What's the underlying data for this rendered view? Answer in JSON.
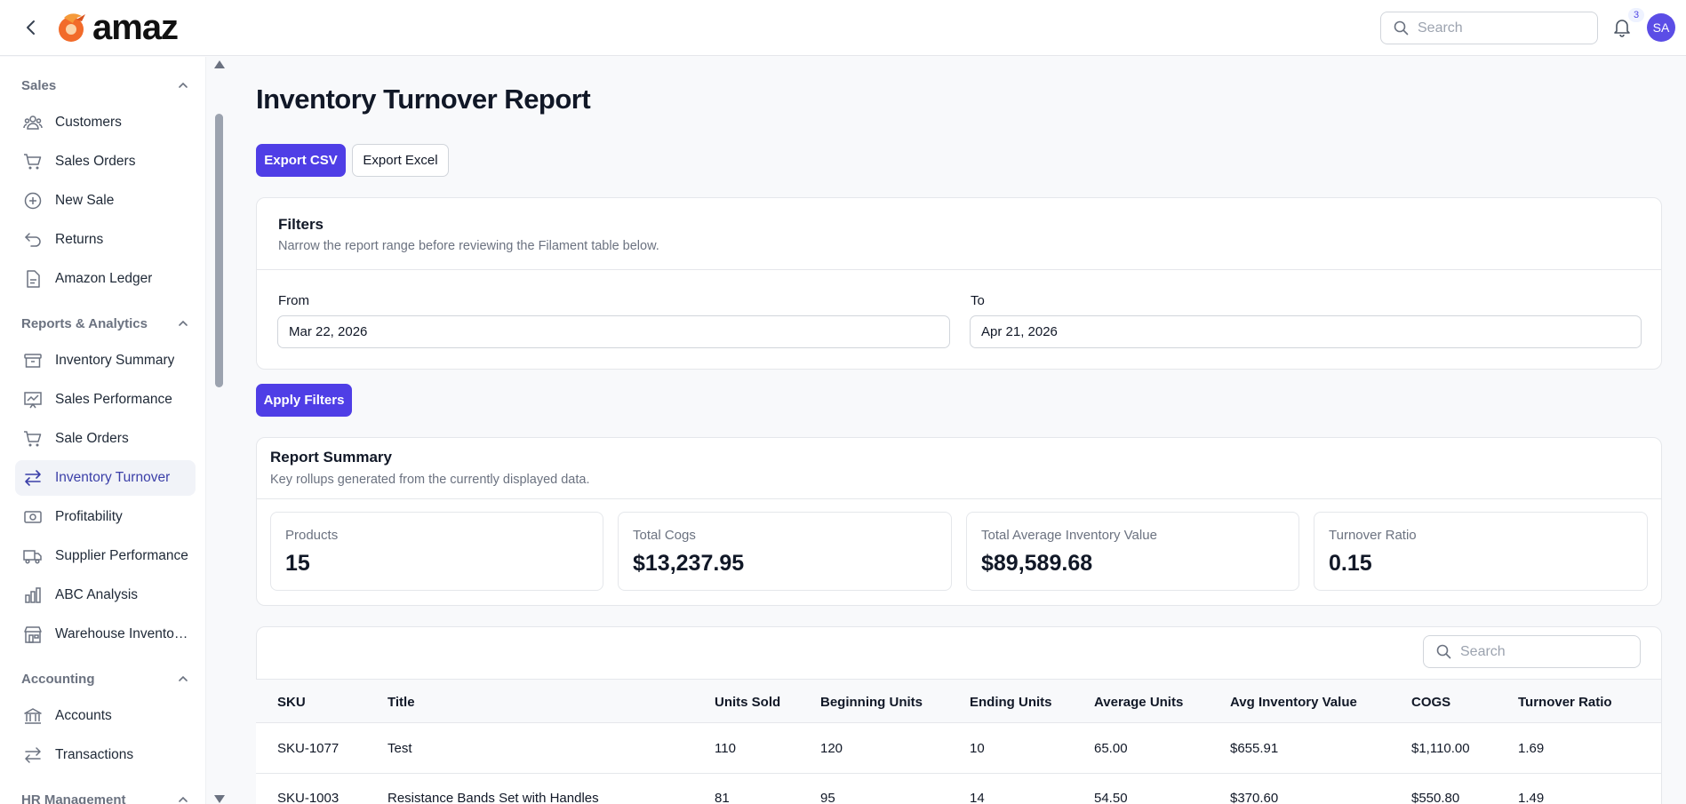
{
  "header": {
    "logo_text": "amaz",
    "search_placeholder": "Search",
    "notification_count": "3",
    "avatar_initials": "SA"
  },
  "sidebar": {
    "groups": [
      {
        "label": "Sales",
        "items": [
          "Customers",
          "Sales Orders",
          "New Sale",
          "Returns",
          "Amazon Ledger"
        ]
      },
      {
        "label": "Reports & Analytics",
        "items": [
          "Inventory Summary",
          "Sales Performance",
          "Sale Orders",
          "Inventory Turnover",
          "Profitability",
          "Supplier Performance",
          "ABC Analysis",
          "Warehouse Inventor..."
        ]
      },
      {
        "label": "Accounting",
        "items": [
          "Accounts",
          "Transactions"
        ]
      },
      {
        "label": "HR Management",
        "items": []
      }
    ],
    "active_item": "Inventory Turnover"
  },
  "main": {
    "title": "Inventory Turnover Report",
    "export_csv_label": "Export CSV",
    "export_excel_label": "Export Excel",
    "filters": {
      "title": "Filters",
      "subtitle": "Narrow the report range before reviewing the Filament table below.",
      "from_label": "From",
      "from_value": "Mar 22, 2026",
      "to_label": "To",
      "to_value": "Apr 21, 2026"
    },
    "apply_label": "Apply Filters",
    "summary": {
      "title": "Report Summary",
      "subtitle": "Key rollups generated from the currently displayed data.",
      "stats": [
        {
          "label": "Products",
          "value": "15"
        },
        {
          "label": "Total Cogs",
          "value": "$13,237.95"
        },
        {
          "label": "Total Average Inventory Value",
          "value": "$89,589.68"
        },
        {
          "label": "Turnover Ratio",
          "value": "0.15"
        }
      ]
    },
    "table": {
      "search_placeholder": "Search",
      "columns": [
        "SKU",
        "Title",
        "Units Sold",
        "Beginning Units",
        "Ending Units",
        "Average Units",
        "Avg Inventory Value",
        "COGS",
        "Turnover Ratio"
      ],
      "rows": [
        [
          "SKU-1077",
          "Test",
          "110",
          "120",
          "10",
          "65.00",
          "$655.91",
          "$1,110.00",
          "1.69"
        ],
        [
          "SKU-1003",
          "Resistance Bands Set with Handles",
          "81",
          "95",
          "14",
          "54.50",
          "$370.60",
          "$550.80",
          "1.49"
        ]
      ]
    }
  },
  "colors": {
    "primary": "#4f3ee6",
    "active_nav_text": "#3b3fa8",
    "avatar": "#5b4de6"
  }
}
